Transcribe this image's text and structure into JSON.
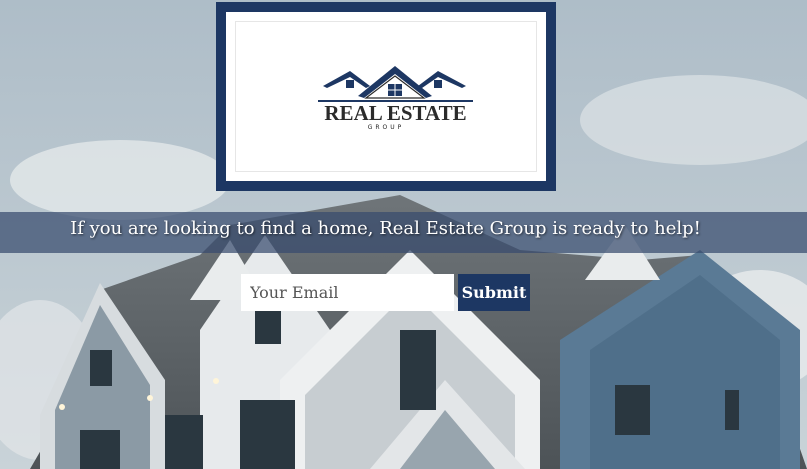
{
  "logo": {
    "title": "REAL ESTATE",
    "subtitle": "GROUP",
    "brand_color": "#1d3763"
  },
  "banner": {
    "tagline": "If you are looking to find a home, Real Estate Group is ready to help!"
  },
  "signup": {
    "email_placeholder": "Your Email",
    "submit_label": "Submit"
  },
  "colors": {
    "accent": "#1d3763",
    "banner_bg": "#374b6e"
  }
}
